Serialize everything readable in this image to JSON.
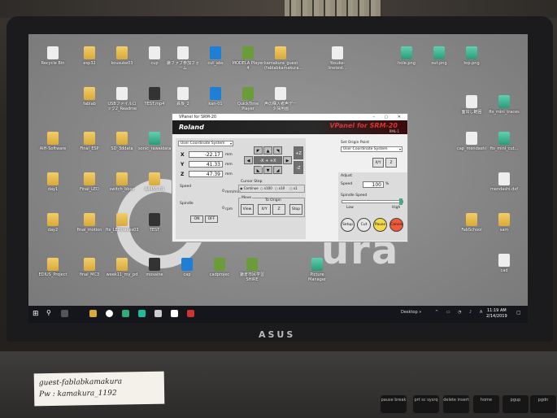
{
  "desktop_icons": [
    {
      "label": "Recycle Bin",
      "type": "file"
    },
    {
      "label": "esp32",
      "type": "folder"
    },
    {
      "label": "kousuke03",
      "type": "folder"
    },
    {
      "label": "cup",
      "type": "file"
    },
    {
      "label": "鎌ファブ参加フォーム",
      "type": "file"
    },
    {
      "label": "cut_abs",
      "type": "ie"
    },
    {
      "label": "MODELA Player 4",
      "type": "app"
    },
    {
      "label": "kamakura_guest (fablabkamakura...",
      "type": "folder"
    },
    {
      "label": "Yosuke-linetest...",
      "type": "file"
    },
    {
      "label": "hole.png",
      "type": "img"
    },
    {
      "label": "out.png",
      "type": "img"
    },
    {
      "label": "top.png",
      "type": "img"
    },
    {
      "label": "fablab",
      "type": "folder"
    },
    {
      "label": "USBファイルロック2_Readme",
      "type": "file"
    },
    {
      "label": "TEST.mp4",
      "type": "vid"
    },
    {
      "label": "鉄板_2",
      "type": "file"
    },
    {
      "label": "kan-01",
      "type": "ie"
    },
    {
      "label": "QuickTime Player",
      "type": "app"
    },
    {
      "label": "声の購入者声データ採用画",
      "type": "file"
    },
    {
      "label": "面出し範囲",
      "type": "file"
    },
    {
      "label": "fts_mini_traces",
      "type": "img"
    },
    {
      "label": "AIH-Software",
      "type": "folder"
    },
    {
      "label": "Final_ESP",
      "type": "folder"
    },
    {
      "label": "SD_3ddata",
      "type": "folder"
    },
    {
      "label": "sonic_rawaldata",
      "type": "img"
    },
    {
      "label": "cap_mendashi",
      "type": "file"
    },
    {
      "label": "fts_mini_cut...",
      "type": "img"
    },
    {
      "label": "day1",
      "type": "folder"
    },
    {
      "label": "Final_LED",
      "type": "folder"
    },
    {
      "label": "switch_bbox",
      "type": "folder"
    },
    {
      "label": "A4455-01",
      "type": "folder"
    },
    {
      "label": "mendashi.dxf",
      "type": "file"
    },
    {
      "label": "day2",
      "type": "folder"
    },
    {
      "label": "final_motion",
      "type": "folder"
    },
    {
      "label": "fts_LEDtraces03",
      "type": "folder"
    },
    {
      "label": "TEST",
      "type": "vid"
    },
    {
      "label": "FabSchool",
      "type": "folder"
    },
    {
      "label": "sam",
      "type": "folder"
    },
    {
      "label": "EDIUS_Project",
      "type": "folder"
    },
    {
      "label": "final_MC3",
      "type": "folder"
    },
    {
      "label": "week11_my_pd",
      "type": "folder"
    },
    {
      "label": "mosaine",
      "type": "vid"
    },
    {
      "label": "cap",
      "type": "ie"
    },
    {
      "label": "cadprojec",
      "type": "app"
    },
    {
      "label": "鎌倉市民学習SHIRE",
      "type": "app"
    },
    {
      "label": "Picture Manager",
      "type": "img"
    },
    {
      "label": "cad",
      "type": "file"
    }
  ],
  "wallpaper": {
    "line1": "ab",
    "line2": "ura"
  },
  "vpanel": {
    "window_title": "VPanel for SRM-20",
    "brand": "Roland",
    "model": "VPanel for SRM-20",
    "model_sub": "RML-1",
    "coord_system": "User Coordinate System",
    "axes": [
      {
        "label": "X",
        "value": "-22.17",
        "unit": "mm"
      },
      {
        "label": "Y",
        "value": "41.33",
        "unit": "mm"
      },
      {
        "label": "Z",
        "value": "47.39",
        "unit": "mm"
      }
    ],
    "speed_label": "Speed",
    "speed_value": "0",
    "speed_unit": "mm/min",
    "spindle_label": "Spindle",
    "spindle_value": "0",
    "spindle_unit": "rpm",
    "spindle_on": "ON",
    "spindle_off": "OFF",
    "jog": {
      "up": "+Y",
      "down": "-Y",
      "left": "-X",
      "right": "+X",
      "center": "+",
      "zup": "+Z",
      "zdown": "-Z"
    },
    "cursor_step_label": "Cursor Step",
    "cursor_steps": [
      "Continue",
      "x100",
      "x10",
      "x1"
    ],
    "move_label": "Move",
    "to_origin_label": "To Origin",
    "move_buttons": [
      "View",
      "X/Y",
      "Z",
      "Stop"
    ],
    "set_origin_label": "Set Origin Point",
    "set_origin_system": "User Coordinate System",
    "origin_buttons": [
      "X/Y",
      "Z"
    ],
    "adjust_label": "Adjust",
    "adjust_speed_label": "Speed",
    "adjust_speed_value": "100",
    "adjust_speed_unit": "%",
    "spindle_speed_label": "Spindle Speed",
    "spindle_low": "Low",
    "spindle_high": "High",
    "action_buttons": [
      {
        "label": "Setup",
        "color": "#e6e6e6"
      },
      {
        "label": "Cut",
        "color": "#e6e6e6"
      },
      {
        "label": "Pause",
        "color": "#f2d84a"
      },
      {
        "label": "Cancel",
        "color": "#f05a3a"
      }
    ]
  },
  "taskbar": {
    "desktop_label": "Desktop",
    "time": "11:19 AM",
    "date": "2/14/2019"
  },
  "laptop_brand": "ASUS",
  "sticker": {
    "line1": "guest-fablabkamakura",
    "line2": "Pw : kamakura_1192"
  },
  "keys": [
    "pause break",
    "prt sc sysrq",
    "delete insert",
    "home",
    "pgup",
    "pgdn"
  ]
}
